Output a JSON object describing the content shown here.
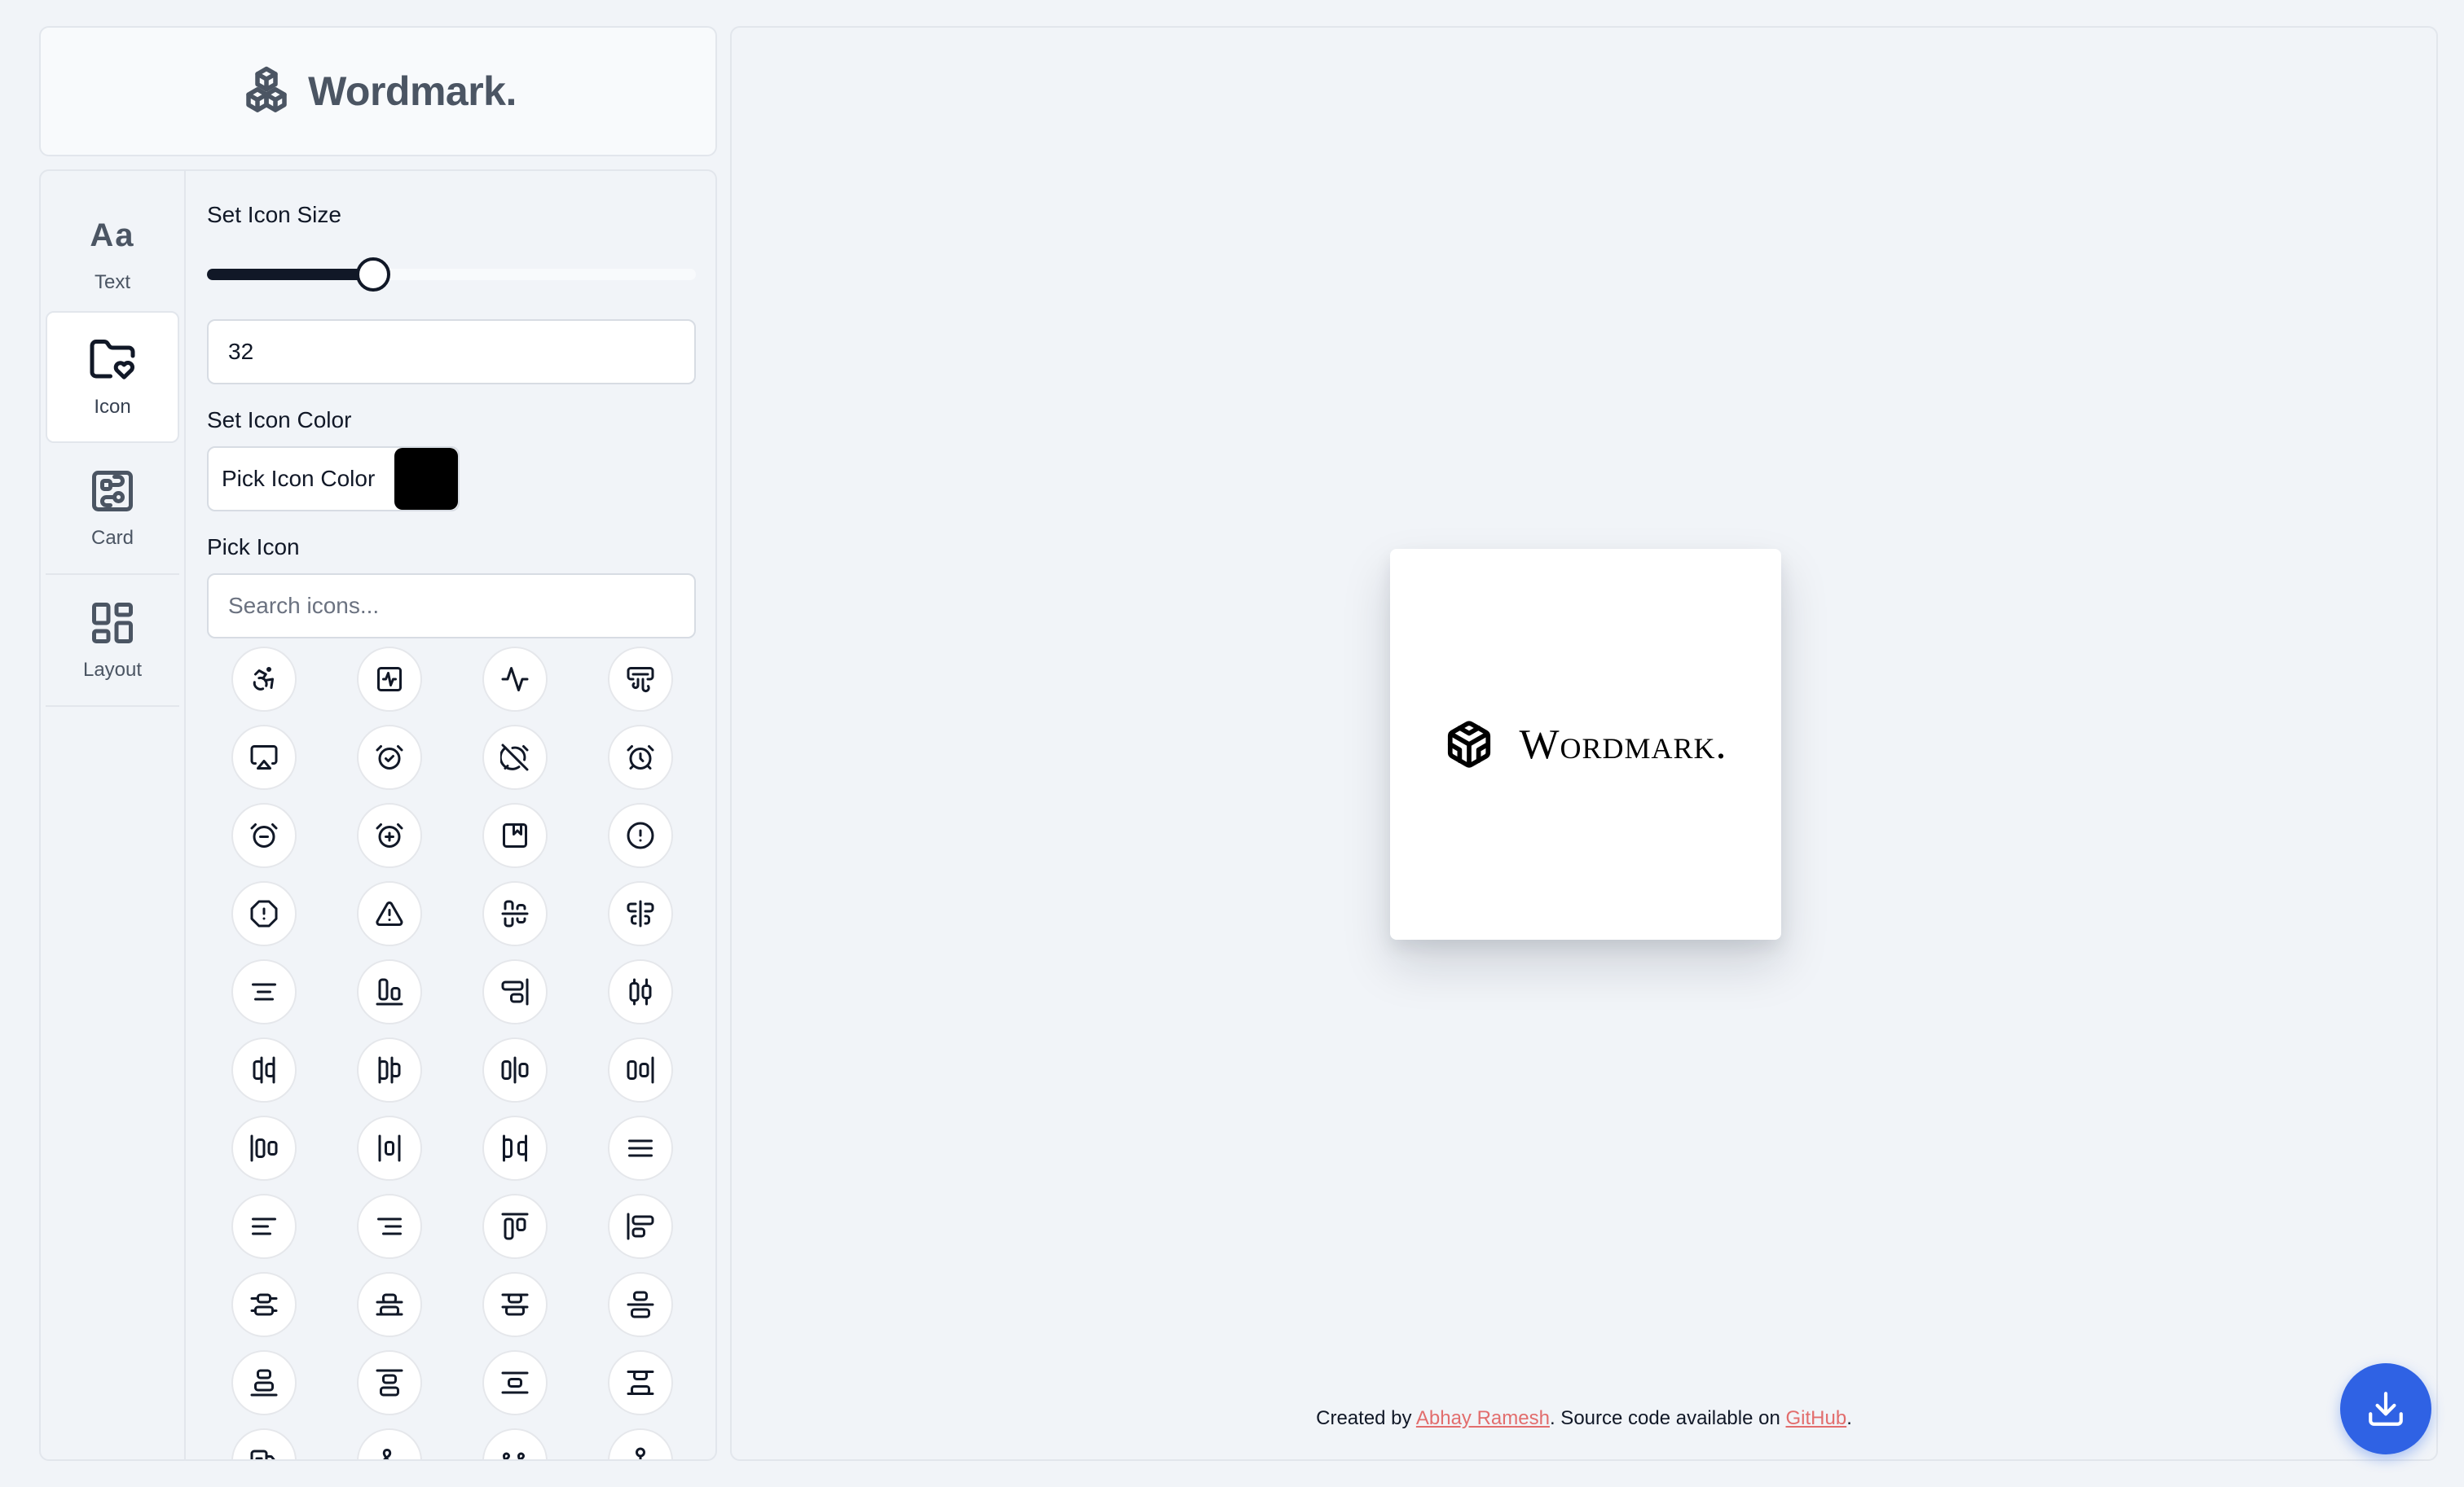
{
  "brand": {
    "title": "Wordmark.",
    "icon": "cubes-icon"
  },
  "tabs": [
    {
      "label": "Text",
      "icon": "text-aa-icon",
      "glyph": "Aa",
      "active": false
    },
    {
      "label": "Icon",
      "icon": "folder-heart-icon",
      "active": true
    },
    {
      "label": "Card",
      "icon": "card-layout-icon",
      "active": false
    },
    {
      "label": "Layout",
      "icon": "layout-grid-icon",
      "active": false
    }
  ],
  "icon_size": {
    "label": "Set Icon Size",
    "value": "32",
    "slider_fraction": 0.34
  },
  "icon_color": {
    "label": "Set Icon Color",
    "button_label": "Pick Icon Color",
    "value": "#000000"
  },
  "pick_icon": {
    "label": "Pick Icon",
    "search_placeholder": "Search icons...",
    "icons": [
      "accessible-icon",
      "activity-square-icon",
      "activity-icon",
      "air-vent-icon",
      "airplay-icon",
      "alarm-check-icon",
      "alarm-off-icon",
      "alarm-clock-icon",
      "alarm-minus-icon",
      "alarm-plus-icon",
      "album-icon",
      "alert-circle-icon",
      "alert-octagon-icon",
      "alert-triangle-icon",
      "align-center-horizontal-icon",
      "align-center-vertical-icon",
      "align-center-icon",
      "align-end-horizontal-icon",
      "align-end-vertical-icon",
      "align-horizontal-distribute-center-icon",
      "align-horizontal-distribute-end-icon",
      "align-horizontal-distribute-start-icon",
      "align-horizontal-justify-center-icon",
      "align-horizontal-justify-end-icon",
      "align-horizontal-justify-start-icon",
      "align-horizontal-space-around-icon",
      "align-horizontal-space-between-icon",
      "align-justify-icon",
      "align-left-icon",
      "align-right-icon",
      "align-start-horizontal-icon",
      "align-start-vertical-icon",
      "align-vertical-distribute-center-icon",
      "align-vertical-distribute-end-icon",
      "align-vertical-distribute-start-icon",
      "align-vertical-justify-center-icon",
      "align-vertical-justify-end-icon",
      "align-vertical-justify-start-icon",
      "align-vertical-space-around-icon",
      "align-vertical-space-between-icon",
      "ambulance-icon",
      "ampersand-icon",
      "ampersands-icon",
      "anchor-icon"
    ]
  },
  "preview": {
    "wordmark": "Wordmark.",
    "icon": "cubes-outline-icon",
    "icon_color": "#000000"
  },
  "footer": {
    "prefix": "Created by ",
    "author": "Abhay Ramesh",
    "middle": ". Source code available on ",
    "repo": "GitHub",
    "suffix": "."
  },
  "download": {
    "icon": "download-icon"
  },
  "colors": {
    "background": "#f1f4f8",
    "accent": "#2f62e4",
    "link": "#e26d6d",
    "slider": "#111827"
  }
}
